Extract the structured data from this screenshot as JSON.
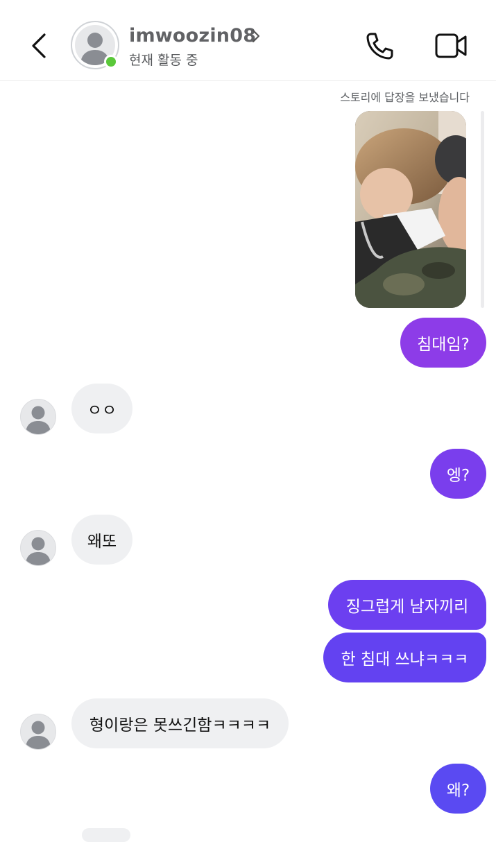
{
  "header": {
    "username": "imwoozin08",
    "status": "현재 활동 중",
    "online_color": "#5ac83a",
    "icons": [
      "back-chevron-icon",
      "profile-chevron-icon",
      "phone-icon",
      "video-camera-icon"
    ]
  },
  "messages": {
    "story_note": "스토리에 답장을 보냈습니다",
    "story_image_description": "",
    "m1": "침대임?",
    "m2": "ㅇㅇ",
    "m3": "엥?",
    "m4": "왜또",
    "m5": "징그럽게 남자끼리",
    "m6": "한 침대 쓰냐ㅋㅋㅋ",
    "m7": "형이랑은 못쓰긴함ㅋㅋㅋㅋ",
    "m8": "왜?"
  },
  "colors": {
    "bubble_out_top": "#8d3ce8",
    "bubble_out_mid": "#6c3ff0",
    "bubble_out_bottom": "#5a4af2",
    "bubble_in": "#eff0f2"
  }
}
